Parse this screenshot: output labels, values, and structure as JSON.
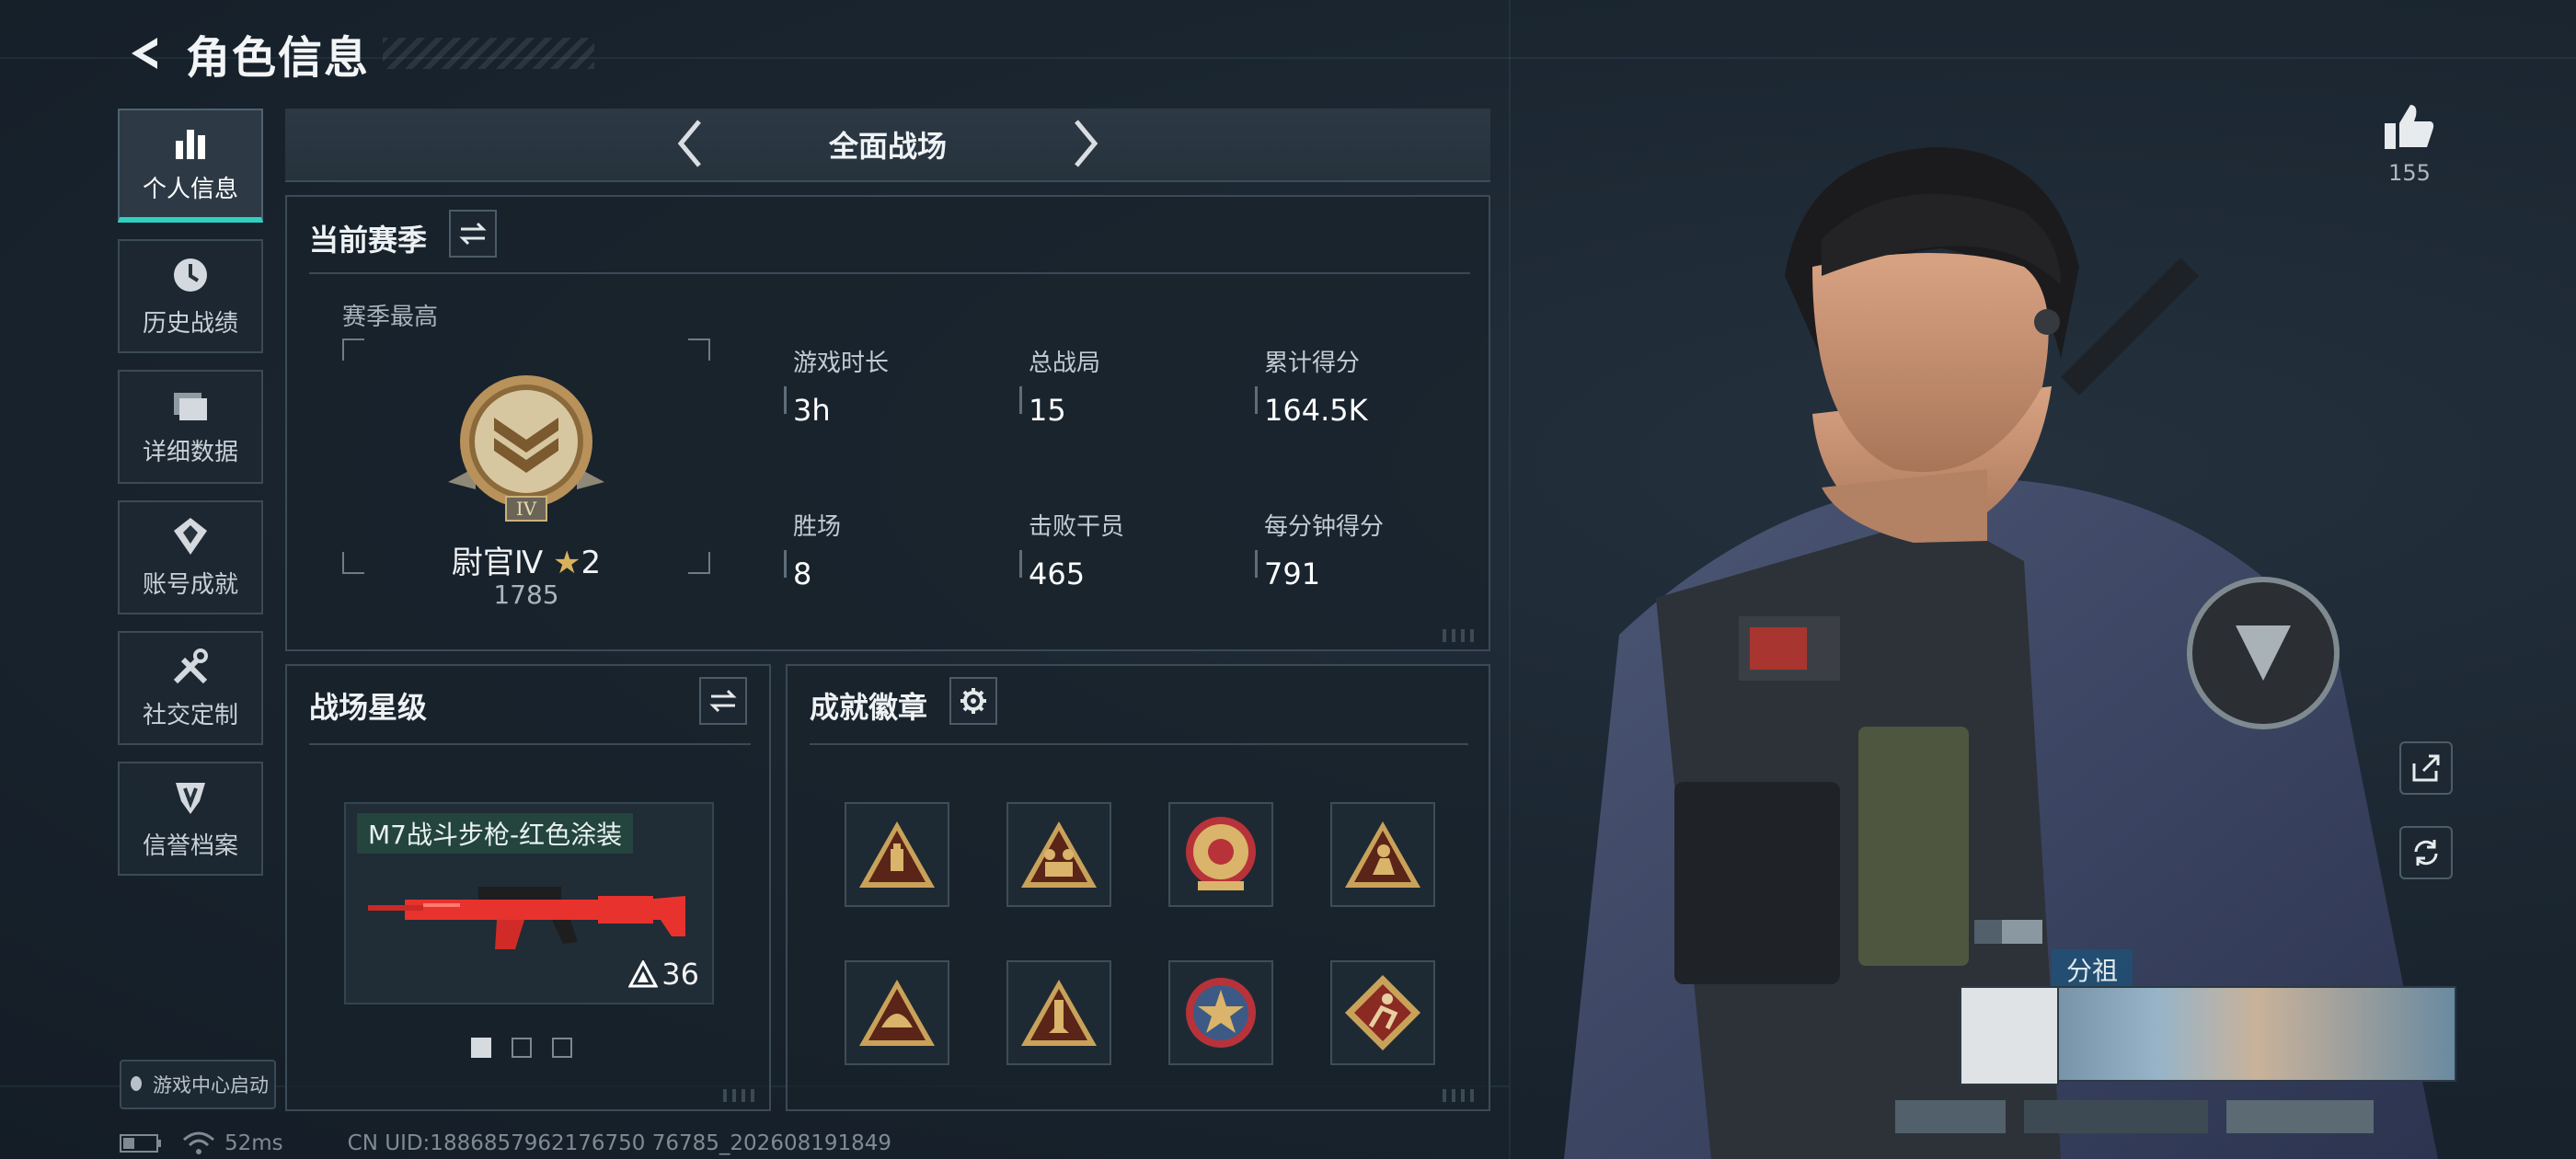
{
  "header": {
    "title": "角色信息"
  },
  "sidebar": {
    "items": [
      {
        "label": "个人信息",
        "icon": "bar-chart-icon",
        "active": true
      },
      {
        "label": "历史战绩",
        "icon": "clock-icon",
        "active": false
      },
      {
        "label": "详细数据",
        "icon": "folder-icon",
        "active": false
      },
      {
        "label": "账号成就",
        "icon": "medal-icon",
        "active": false
      },
      {
        "label": "社交定制",
        "icon": "tools-icon",
        "active": false
      },
      {
        "label": "信誉档案",
        "icon": "shield-icon",
        "active": false
      }
    ],
    "game_center": "游戏中心启动"
  },
  "mode": {
    "title": "全面战场"
  },
  "season": {
    "title": "当前赛季",
    "best_label": "赛季最高",
    "rank_name": "尉官Ⅳ",
    "rank_stars": "2",
    "rank_score": "1785",
    "rank_emblem_numeral": "IV",
    "stats": [
      {
        "label": "游戏时长",
        "value": "3h"
      },
      {
        "label": "总战局",
        "value": "15"
      },
      {
        "label": "累计得分",
        "value": "164.5K"
      },
      {
        "label": "胜场",
        "value": "8"
      },
      {
        "label": "击败干员",
        "value": "465"
      },
      {
        "label": "每分钟得分",
        "value": "791"
      }
    ]
  },
  "battlefield_star": {
    "title": "战场星级",
    "weapon_name": "M7战斗步枪-红色涂装",
    "weapon_level": "36",
    "pages": 3,
    "current_page": 1
  },
  "achievements": {
    "title": "成就徽章",
    "badges": [
      {
        "icon": "ammo-badge-icon",
        "shape": "triangle"
      },
      {
        "icon": "squad-badge-icon",
        "shape": "triangle"
      },
      {
        "icon": "emblem-badge-icon",
        "shape": "circle"
      },
      {
        "icon": "soldier-badge-icon",
        "shape": "triangle"
      },
      {
        "icon": "helmet-badge-icon",
        "shape": "triangle"
      },
      {
        "icon": "rocket-badge-icon",
        "shape": "triangle"
      },
      {
        "icon": "star-medal-badge-icon",
        "shape": "circle"
      },
      {
        "icon": "runner-badge-icon",
        "shape": "diamond"
      }
    ]
  },
  "status": {
    "ping": "52ms",
    "uid": "CN UID:1886857962176750 76785_202608191849"
  },
  "profile": {
    "likes": "155",
    "card_name_fragment": "分祖"
  },
  "colors": {
    "accent": "#2fd0c0",
    "gold": "#c9a25a",
    "weapon_red": "#e8322d"
  }
}
